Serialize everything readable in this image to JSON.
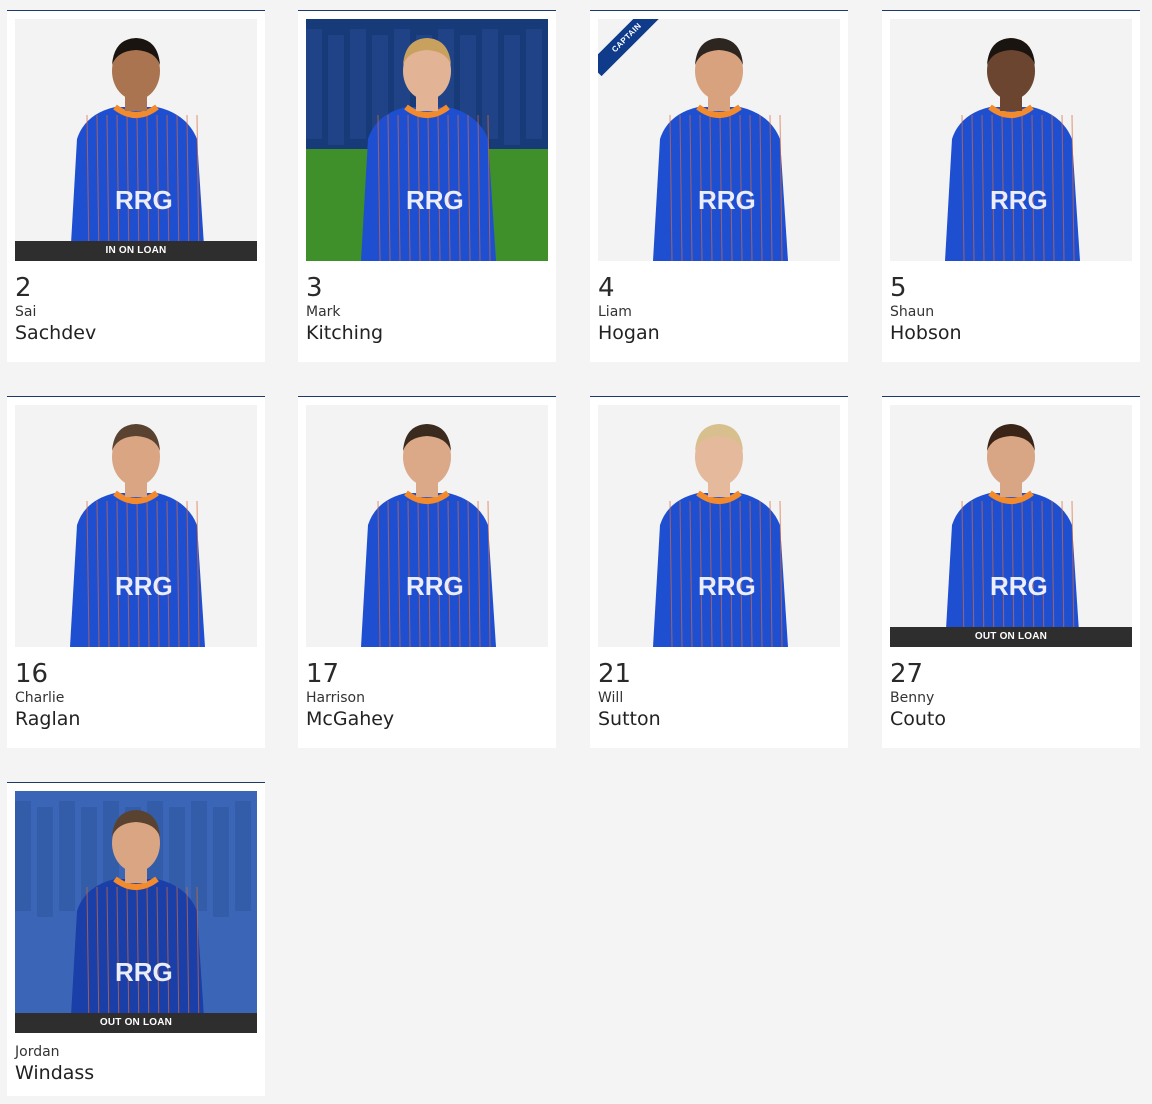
{
  "players": [
    {
      "number": "2",
      "first": "Sai",
      "last": "Sachdev",
      "tag": "IN ON LOAN",
      "kit": "#1f4fd1",
      "bg": "#f3f3f3",
      "skin": "#a9744f",
      "hair": "#1a1410"
    },
    {
      "number": "3",
      "first": "Mark",
      "last": "Kitching",
      "tag": "",
      "kit": "#1f4fd1",
      "bg": "#173a78",
      "skin": "#e2b394",
      "hair": "#c9a15f",
      "action": true
    },
    {
      "number": "4",
      "first": "Liam",
      "last": "Hogan",
      "tag": "",
      "captain": "CAPTAIN",
      "kit": "#1f4fd1",
      "bg": "#f3f3f3",
      "skin": "#d9a27f",
      "hair": "#2d2620"
    },
    {
      "number": "5",
      "first": "Shaun",
      "last": "Hobson",
      "tag": "",
      "kit": "#1f4fd1",
      "bg": "#f3f3f3",
      "skin": "#6b4530",
      "hair": "#1a1410"
    },
    {
      "number": "16",
      "first": "Charlie",
      "last": "Raglan",
      "tag": "",
      "kit": "#1f4fd1",
      "bg": "#f3f3f3",
      "skin": "#d9a583",
      "hair": "#5a4230"
    },
    {
      "number": "17",
      "first": "Harrison",
      "last": "McGahey",
      "tag": "",
      "kit": "#1f4fd1",
      "bg": "#f3f3f3",
      "skin": "#dba988",
      "hair": "#3b2b1f"
    },
    {
      "number": "21",
      "first": "Will",
      "last": "Sutton",
      "tag": "",
      "kit": "#1f4fd1",
      "bg": "#f3f3f3",
      "skin": "#e5b99b",
      "hair": "#d8c08e"
    },
    {
      "number": "27",
      "first": "Benny",
      "last": "Couto",
      "tag": "OUT ON LOAN",
      "kit": "#1f4fd1",
      "bg": "#f3f3f3",
      "skin": "#d8a684",
      "hair": "#3a2418"
    },
    {
      "number": "",
      "first": "Jordan",
      "last": "Windass",
      "tag": "OUT ON LOAN",
      "kit": "#1a3fa8",
      "bg": "#3b66b8",
      "skin": "#d9a583",
      "hair": "#5a4230",
      "action": true
    }
  ],
  "colors": {
    "accent": "#1d3a6e",
    "kit_trim": "#f28a2e",
    "tag_bg": "#2e2e2e",
    "captain_bg": "#0f3b8a"
  }
}
